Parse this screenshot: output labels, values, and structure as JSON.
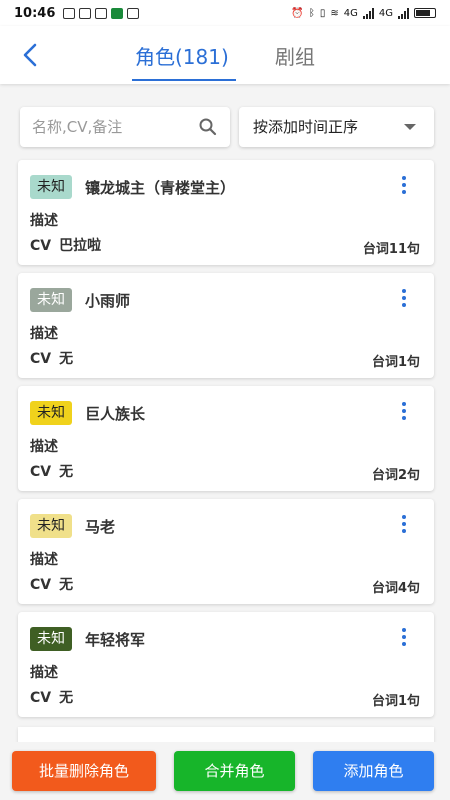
{
  "status_bar": {
    "time": "10:46",
    "net_tag_1": "4G",
    "net_tag_2": "4G"
  },
  "header": {
    "active_tab": "角色(181)",
    "inactive_tab": "剧组"
  },
  "filters": {
    "search_placeholder": "名称,CV,备注",
    "sort_label": "按添加时间正序"
  },
  "colors": {
    "accent": "#2b6fd6",
    "delete_button": "#f25a1c",
    "merge_button": "#17b52a",
    "add_button": "#2f7ef0"
  },
  "roles": [
    {
      "badge": "未知",
      "badge_bg": "#a9d9cc",
      "badge_fg": "#222222",
      "name": "镶龙城主（青楼堂主）",
      "desc_label": "描述",
      "cv_label": "CV",
      "cv_value": "巴拉啦",
      "lines": "台词11句"
    },
    {
      "badge": "未知",
      "badge_bg": "#9aa79c",
      "badge_fg": "#ffffff",
      "name": "小雨师",
      "desc_label": "描述",
      "cv_label": "CV",
      "cv_value": "无",
      "lines": "台词1句"
    },
    {
      "badge": "未知",
      "badge_bg": "#f0d21c",
      "badge_fg": "#222222",
      "name": "巨人族长",
      "desc_label": "描述",
      "cv_label": "CV",
      "cv_value": "无",
      "lines": "台词2句"
    },
    {
      "badge": "未知",
      "badge_bg": "#f0e08a",
      "badge_fg": "#222222",
      "name": "马老",
      "desc_label": "描述",
      "cv_label": "CV",
      "cv_value": "无",
      "lines": "台词4句"
    },
    {
      "badge": "未知",
      "badge_bg": "#3f5f24",
      "badge_fg": "#ffffff",
      "name": "年轻将军",
      "desc_label": "描述",
      "cv_label": "CV",
      "cv_value": "无",
      "lines": "台词1句"
    }
  ],
  "bottom_buttons": {
    "delete_label": "批量删除角色",
    "merge_label": "合并角色",
    "add_label": "添加角色"
  }
}
